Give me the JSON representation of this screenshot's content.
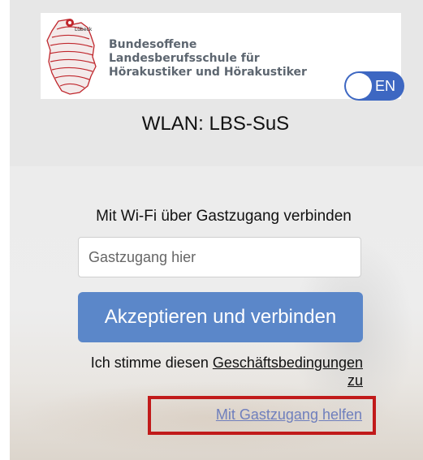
{
  "header": {
    "logo": {
      "map_label": "Lübeck",
      "lines": [
        "Bundesoffene",
        "Landesberufsschule für",
        "Hörakustiker und Hörakustiker"
      ]
    },
    "language_toggle": {
      "label": "EN",
      "state": "on"
    }
  },
  "network": {
    "title": "WLAN: LBS-SuS"
  },
  "form": {
    "heading": "Mit Wi-Fi über Gastzugang verbinden",
    "guest_code": {
      "placeholder": "Gastzugang hier",
      "value": ""
    },
    "accept_button": "Akzeptieren und verbinden",
    "terms": {
      "prefix": "Ich stimme diesen ",
      "link": "Geschäftsbedingungen",
      "suffix": "zu"
    },
    "help_link": "Mit Gastzugang helfen"
  },
  "colors": {
    "header_background": "#e7e7e7",
    "toggle_blue": "#3d67c2",
    "button_blue": "#5b87c9",
    "help_link": "#6f7fbd",
    "highlight_red": "#c11a1a",
    "map_red": "#c0272d"
  }
}
